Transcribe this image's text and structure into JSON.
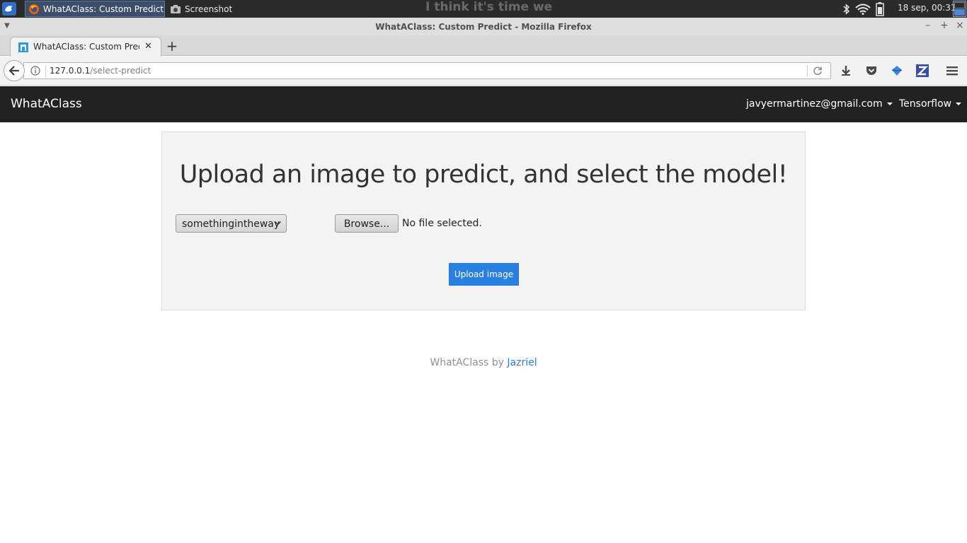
{
  "taskbar": {
    "tasks": [
      {
        "label": "WhatAClass: Custom Predict...",
        "active": true
      },
      {
        "label": "Screenshot",
        "active": false
      }
    ],
    "overlay_text": "I think it's time we",
    "clock": "18 sep, 00:31"
  },
  "window": {
    "title": "WhatAClass: Custom Predict - Mozilla Firefox"
  },
  "browser": {
    "tab_label": "WhatAClass: Custom Predict",
    "url_host": "127.0.0.1",
    "url_path": "/select-predict"
  },
  "site": {
    "brand": "WhatAClass",
    "nav": {
      "user": "javyermartinez@gmail.com",
      "framework": "Tensorflow"
    },
    "heading": "Upload an image to predict, and select the model!",
    "model_select": "somethingintheway",
    "browse_label": "Browse...",
    "file_status": "No file selected.",
    "upload_label": "Upload image",
    "footer_prefix": "WhatAClass by",
    "footer_link": "Jazriel"
  },
  "colors": {
    "navbar": "#222222",
    "primary_button": "#2a80e0",
    "link": "#2a7fd0"
  }
}
